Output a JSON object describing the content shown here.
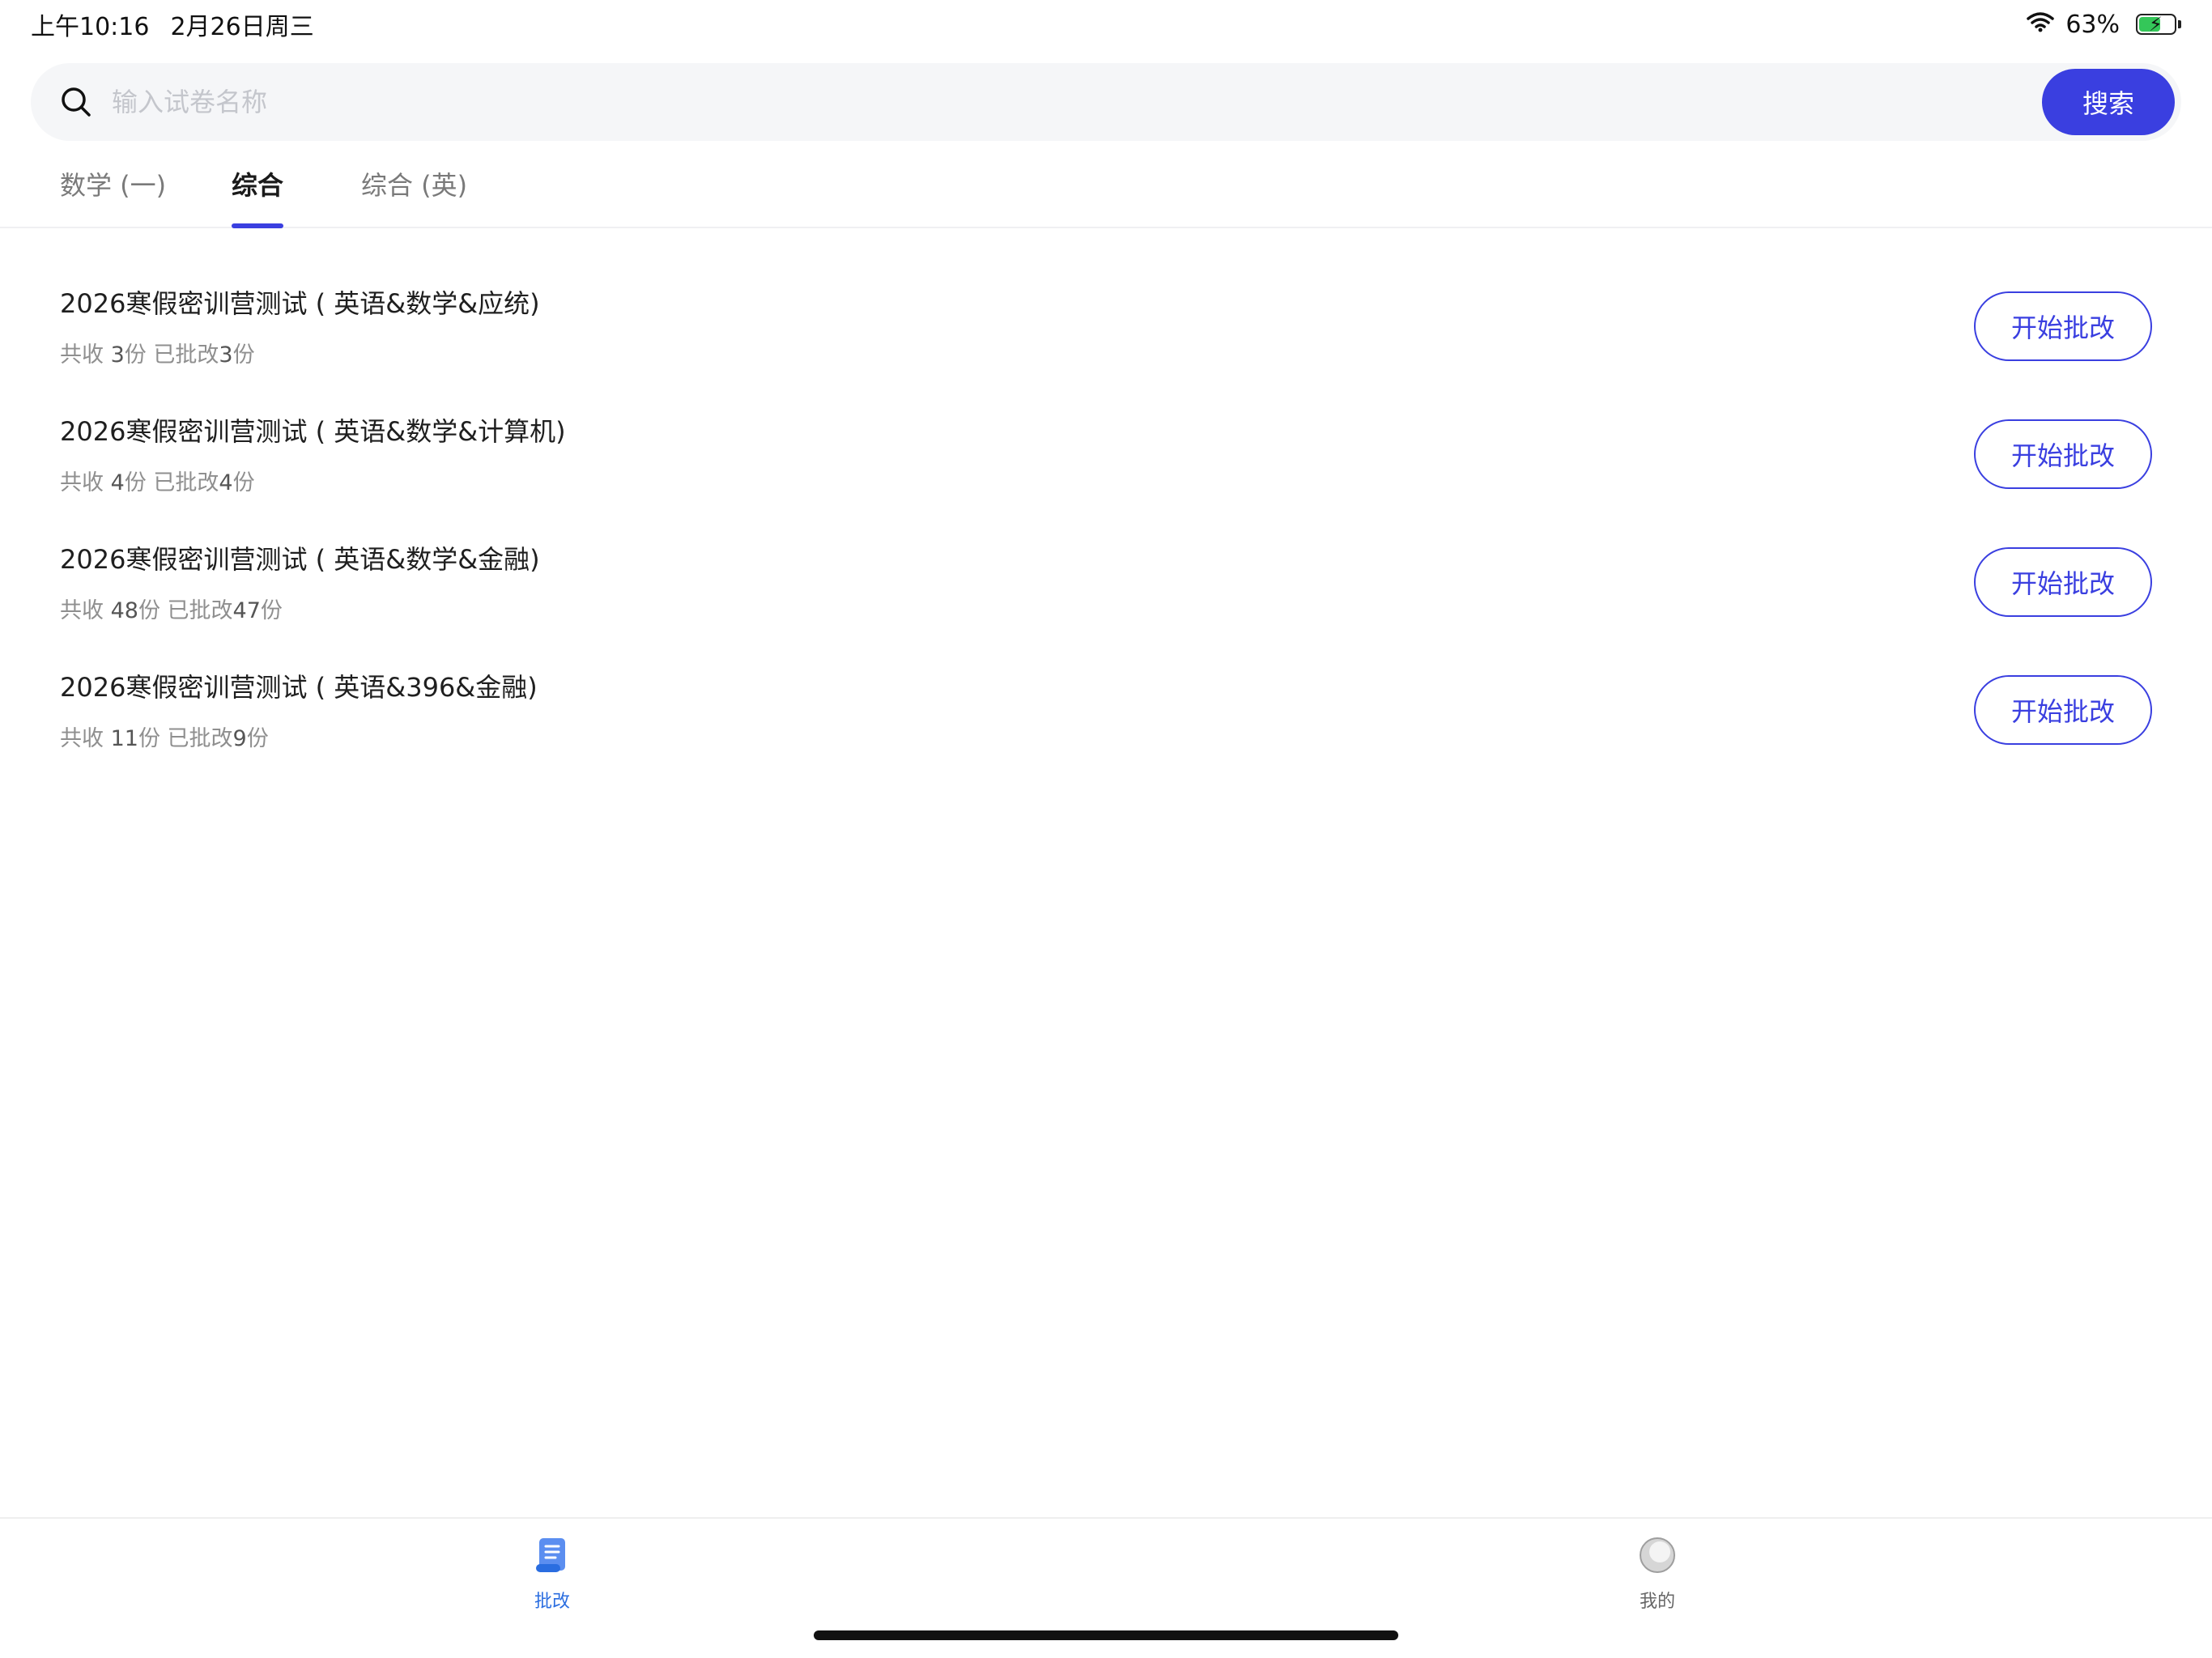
{
  "status_bar": {
    "time": "上午10:16",
    "date": "2月26日周三",
    "battery_percent": "63%",
    "battery_level": 0.63
  },
  "search": {
    "placeholder": "输入试卷名称",
    "value": "",
    "button_label": "搜索"
  },
  "tabs": [
    {
      "label": "数学 (一)",
      "active": false
    },
    {
      "label": "综合",
      "active": true
    },
    {
      "label": "综合 (英)",
      "active": false
    }
  ],
  "exams": [
    {
      "title": "2026寒假密训营测试 ( 英语&数学&应统)",
      "received_label": "共收",
      "received": "3",
      "unit": "份",
      "graded_label": "已批改",
      "graded": "3",
      "button": "开始批改"
    },
    {
      "title": "2026寒假密训营测试 ( 英语&数学&计算机)",
      "received_label": "共收",
      "received": "4",
      "unit": "份",
      "graded_label": "已批改",
      "graded": "4",
      "button": "开始批改"
    },
    {
      "title": "2026寒假密训营测试 ( 英语&数学&金融)",
      "received_label": "共收",
      "received": "48",
      "unit": "份",
      "graded_label": "已批改",
      "graded": "47",
      "button": "开始批改"
    },
    {
      "title": "2026寒假密训营测试 ( 英语&396&金融)",
      "received_label": "共收",
      "received": "11",
      "unit": "份",
      "graded_label": "已批改",
      "graded": "9",
      "button": "开始批改"
    }
  ],
  "bottom_nav": [
    {
      "label": "批改",
      "icon": "grading-scroll-icon",
      "active": true
    },
    {
      "label": "我的",
      "icon": "profile-avatar-icon",
      "active": false
    }
  ],
  "colors": {
    "accent": "#3a3fe0",
    "nav_active": "#2a6de0",
    "battery": "#34c759"
  }
}
